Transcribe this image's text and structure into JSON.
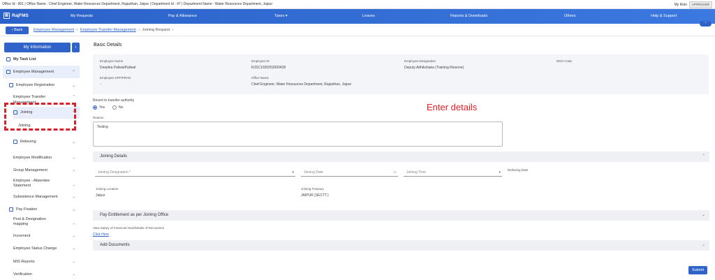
{
  "header": {
    "info_text": "Office Id : 801 | Office Name : Chief Engineer, Water Resources Department, Rajasthan, Jaipur | Department Id : 47 | Department Name : Water Resources Department, Jaipur",
    "role_label": "My Role",
    "role_value": "APPROVER"
  },
  "nav": {
    "app_name": "RajFMS",
    "items": [
      "My Requests",
      "Pay & Allowance",
      "Taxes",
      "Leaves",
      "Reports & Downloads",
      "Others",
      "Help & Support"
    ]
  },
  "breadcrumb": {
    "back": "Back",
    "items": [
      "Employee Management",
      "Employee Transfer Management",
      "Joining Request"
    ]
  },
  "sidebar": {
    "title": "My Information",
    "task_list": "My Task List",
    "employee_management": "Employee Management",
    "employee_registration": "Employee Registration",
    "employee_transfer": "Employee Transfer Management",
    "joining": "Joining",
    "joining_sub": "Joining",
    "relieving": "Relieving",
    "employee_modification": "Employee Modification",
    "group_management": "Group Management",
    "absentee": "Employee - Absentee Statement",
    "subsistence": "Subsistence Management",
    "pay_fixation": "Pay Fixation",
    "post_designation": "Post & Designation mapping",
    "increment": "Increment",
    "status_change": "Employee Status Change",
    "mis_reports": "MIS Reports",
    "verification": "Verification"
  },
  "basic": {
    "title": "Basic Details",
    "employee_name_label": "Employee Name",
    "employee_name": "Deepika PaliwalPaliwal",
    "employee_id_label": "Employee ID",
    "employee_id": "RJSC1920252000428",
    "designation_label": "Employee Designation",
    "designation": "Deputy Adhikshaka (Training Reserve)",
    "ddo_label": "DDO Code",
    "gpf_label": "Employee GPF/PRAN",
    "gpf": "-",
    "office_label": "Office Name",
    "office": "Chief Engineer, Water Resources Department, Rajasthan, Jaipur",
    "revert_label": "Revert to transfer authority",
    "yes": "Yes",
    "no": "No",
    "reason_label": "Reason",
    "reason_value": "Testing"
  },
  "annotation": "Enter details",
  "joining": {
    "title": "Joining Details",
    "designation_placeholder": "Joining Designation *",
    "date_placeholder": "Joining Date",
    "time_placeholder": "Joining Time",
    "relieving_label": "Relieving Date",
    "location_label": "Joining Location",
    "location": "Jaipur",
    "treasury_label": "Joining Treasury",
    "treasury": "JAIPUR (SECTT.)"
  },
  "pay": {
    "title": "Pay Entitlement as per Joining Office",
    "salary_text": "View Salary of Financial Year/Details of Recoveries",
    "click_here": "Click Here"
  },
  "documents": {
    "title": "Add Documents"
  },
  "submit": "Submit"
}
